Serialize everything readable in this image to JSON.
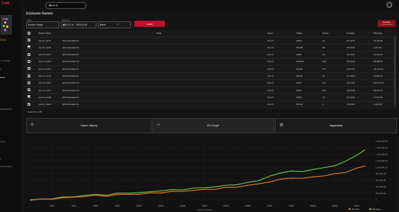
{
  "brand": {
    "logo": "Crab",
    "player": "Croc"
  },
  "sidebar": {
    "items": [
      "n & Labels",
      "ts",
      "ames",
      "",
      "",
      "",
      "",
      "ndle Rounds",
      "",
      "",
      "",
      "",
      "ments",
      "",
      "s",
      "Tournaments"
    ]
  },
  "search": {
    "value": "friend ID"
  },
  "page": {
    "title": "Exclusive Games"
  },
  "filters": {
    "date_label": "Date",
    "date_value": "Custom Range",
    "dates_label": "Dates (A)",
    "dates_value": "2023-01-01 - 2023-04-05",
    "game_value": "Game",
    "stakes_value": ""
  },
  "show_button": "SHOW",
  "download_button": {
    "line1": "Download",
    "line2": "(1,000 items limits)"
  },
  "table": {
    "headers": [
      "Session Start",
      "Table",
      "Game",
      "Stakes",
      "Hands",
      "Duration",
      "Winnings"
    ],
    "rows": [
      [
        "Apr 03, 15:51",
        "EOS Standard 01",
        "PLO-5",
        "25/50",
        "13",
        "01:19:54",
        "13,700.00"
      ],
      [
        "Apr 03, 14:00",
        "EOS Standard 01",
        "PLO-5",
        "50/100",
        "88",
        "00:52:35",
        "1,037.50"
      ],
      [
        "Apr 03, 09:07",
        "EOS Standard 01",
        "PLO-5",
        "25/50",
        "15",
        "01:19:54",
        "14,320.00"
      ],
      [
        "Apr 04, 20:07",
        "EOS Standard 02",
        "PLO-5",
        "100/200",
        "199",
        "04:20:19",
        "56,598.00"
      ],
      [
        "Apr 04, 23:01",
        "EOS Standard 01",
        "PLO-5",
        "50/100",
        "157",
        "02:37:33",
        "-26,191.00"
      ],
      [
        "Apr 04, 14:14",
        "EOS Standard 01",
        "PLO-5",
        "50/100",
        "95",
        "01:48:00",
        "31,803.54"
      ],
      [
        "Apr 04, 14:01",
        "EOS Standard 02",
        "PLO-5",
        "25/50",
        "107",
        "02:17:45",
        "101,791.00"
      ],
      [
        "Apr 04, 14:11",
        "EOS Standard 03",
        "PLO-5",
        "25/50",
        "101",
        "02:00:48",
        "25,001.00"
      ],
      [
        "Apr 04, 01:08",
        "EOS Standard 03",
        "PLO-5",
        "25/50",
        "74",
        "01:49:26",
        "17,572.00"
      ],
      [
        "Apr 03, 15:04",
        "EOS Standard 01",
        "PLO-5",
        "50/100",
        "1",
        "00:00:00",
        "-1,200.00"
      ]
    ],
    "total": "Total Items: 261"
  },
  "tabs": [
    "Game History",
    "EV Graph",
    "Opponents"
  ],
  "chart_data": {
    "type": "line",
    "x_ticks": [
      "2000",
      "4000",
      "6000",
      "8000",
      "10000",
      "12000",
      "14000",
      "16000",
      "18000",
      "20000",
      "22000",
      "24000",
      "26000",
      "28000",
      "30000"
    ],
    "y_ticks": [
      "0",
      "200,000.00",
      "400,000.00",
      "600,000.00",
      "800,000.00",
      "1,000,000.00",
      "1,200,000.00",
      "1,400,000.00",
      "1,600,000.00",
      "1,800,000.00"
    ],
    "xlim": [
      0,
      31500
    ],
    "ylim": [
      -100000,
      1900000
    ],
    "xlabel": "10:00 / 10:00:00",
    "legend": [
      "All-in EV",
      "Winnings"
    ],
    "series": [
      {
        "name": "Winnings",
        "color": "#6cc24a",
        "x": [
          0,
          1000,
          2000,
          3000,
          4000,
          5000,
          6000,
          7000,
          8000,
          9000,
          10000,
          11000,
          12000,
          13000,
          14000,
          15000,
          16000,
          17000,
          18000,
          19000,
          20000,
          21000,
          22000,
          23000,
          24000,
          25000,
          26000,
          27000,
          28000,
          29000,
          30000,
          30800
        ],
        "values": [
          0,
          15000,
          40000,
          70000,
          100000,
          130000,
          160000,
          150000,
          190000,
          220000,
          210000,
          250000,
          280000,
          300000,
          320000,
          350000,
          380000,
          400000,
          440000,
          480000,
          520000,
          600000,
          720000,
          820000,
          900000,
          850000,
          950000,
          980000,
          1050000,
          1200000,
          1350000,
          1560000
        ]
      },
      {
        "name": "All-in EV",
        "color": "#e07a22",
        "x": [
          0,
          1000,
          2000,
          3000,
          4000,
          5000,
          6000,
          7000,
          8000,
          9000,
          10000,
          11000,
          12000,
          13000,
          14000,
          15000,
          16000,
          17000,
          18000,
          19000,
          20000,
          21000,
          22000,
          23000,
          24000,
          25000,
          26000,
          27000,
          28000,
          29000,
          30000,
          30800
        ],
        "values": [
          0,
          10000,
          30000,
          55000,
          80000,
          105000,
          130000,
          120000,
          150000,
          175000,
          170000,
          200000,
          225000,
          245000,
          265000,
          290000,
          315000,
          335000,
          370000,
          400000,
          440000,
          490000,
          560000,
          620000,
          680000,
          650000,
          710000,
          740000,
          790000,
          860000,
          960000,
          1050000
        ]
      }
    ]
  }
}
